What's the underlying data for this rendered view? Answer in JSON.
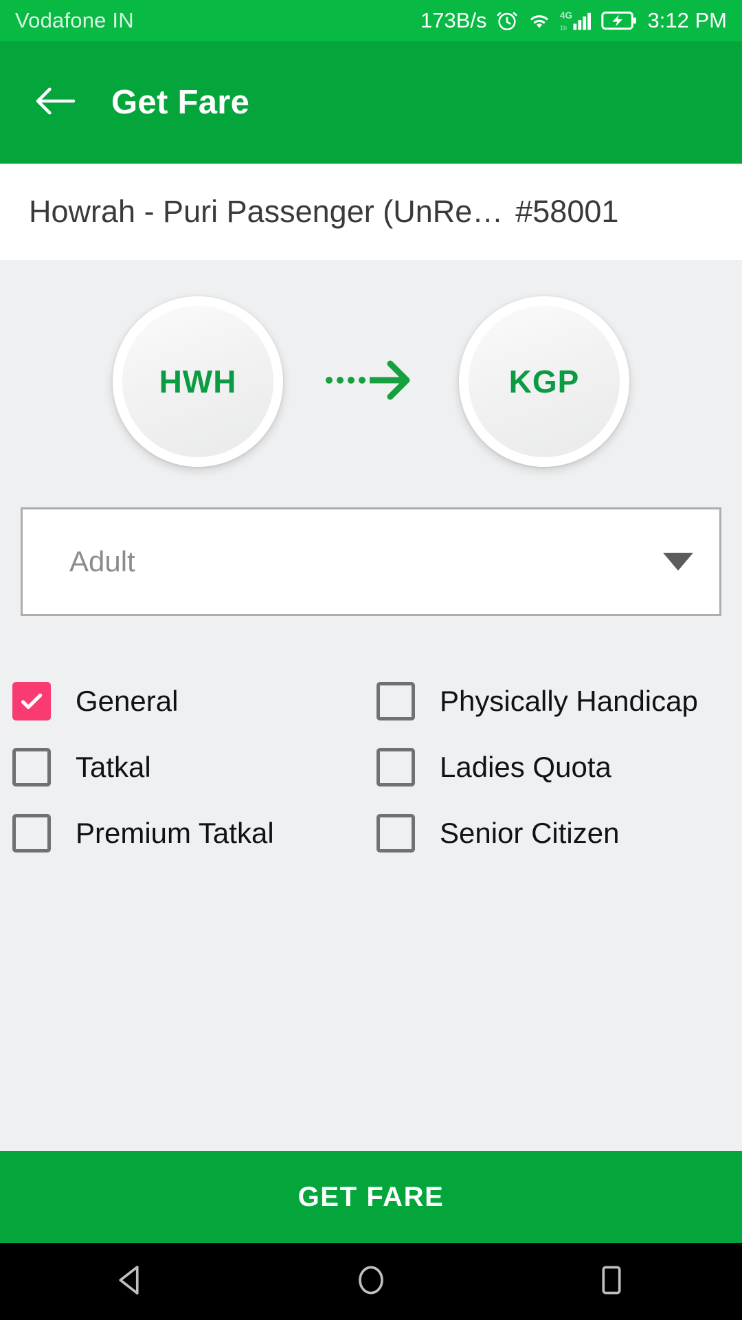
{
  "status_bar": {
    "carrier": "Vodafone IN",
    "network_speed": "173B/s",
    "time": "3:12 PM",
    "icons": [
      "alarm-icon",
      "wifi-icon",
      "signal-4g-icon",
      "battery-charging-icon"
    ]
  },
  "app_bar": {
    "back_icon": "back-arrow-icon",
    "title": "Get Fare"
  },
  "train_header": {
    "name": "Howrah - Puri Passenger (UnRe…",
    "number": "#58001"
  },
  "route": {
    "from_code": "HWH",
    "to_code": "KGP",
    "arrow_icon": "dotted-arrow-right-icon"
  },
  "passenger_type": {
    "selected": "Adult",
    "caret_icon": "chevron-down-icon",
    "options": [
      "Adult"
    ]
  },
  "quotas": [
    {
      "label": "General",
      "checked": true
    },
    {
      "label": "Physically Handicap",
      "checked": false
    },
    {
      "label": "Tatkal",
      "checked": false
    },
    {
      "label": "Ladies Quota",
      "checked": false
    },
    {
      "label": "Premium Tatkal",
      "checked": false
    },
    {
      "label": "Senior Citizen",
      "checked": false
    }
  ],
  "primary_action": {
    "label": "GET FARE"
  },
  "nav_bar": {
    "back": "android-back-icon",
    "home": "android-home-icon",
    "recents": "android-recents-icon"
  },
  "colors": {
    "status_bar_green": "#08b944",
    "app_bar_green": "#04a63c",
    "accent_pink": "#fa3b72",
    "station_text_green": "#0b9b43",
    "page_background": "#eff0f1"
  }
}
